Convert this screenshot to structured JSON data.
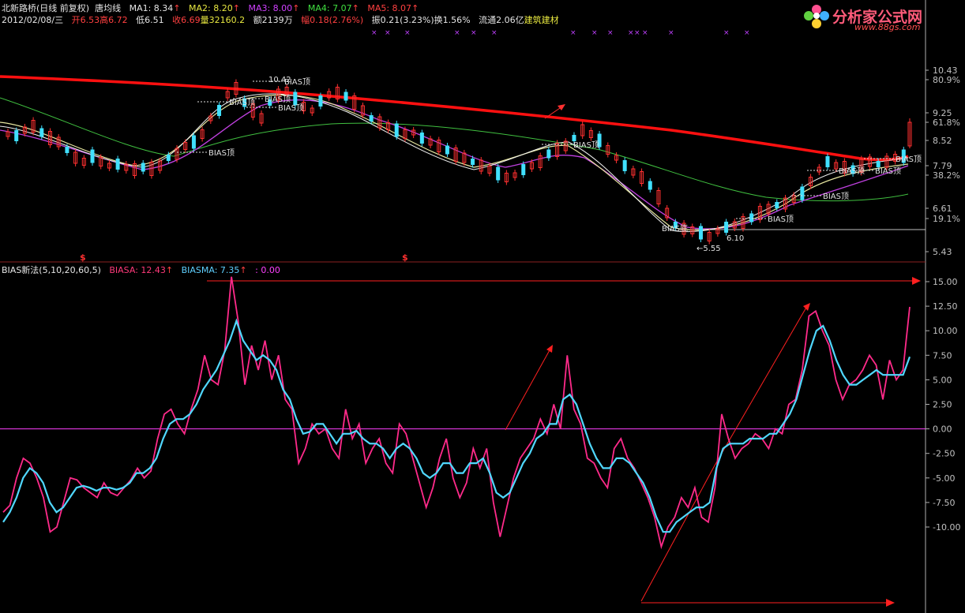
{
  "header": {
    "stock_name": "北新路桥",
    "period": "(日线 前复权)",
    "indicator_name": "唐均线",
    "ma1": "MA1: 8.34",
    "ma2": "MA2: 8.20",
    "ma3": "MA3: 8.00",
    "ma4": "MA4: 7.07",
    "ma5": "MA5: 8.07",
    "date": "2012/02/08/三",
    "open": "开6.53",
    "high": "高6.72",
    "low": "低6.51",
    "close": "收6.69",
    "volume": "量32160.2",
    "amount": "额2139万",
    "change": "幅0.18(2.76%)",
    "amplitude": "振0.21(3.23%)",
    "turnover": "换1.56%",
    "float_cap": "流通2.06亿",
    "sector": "建筑建材",
    "arrow": "↑"
  },
  "logo": {
    "title": "分析家公式网",
    "url": "www.88gs.com"
  },
  "indicator_header": {
    "name": "BIAS新法(5,10,20,60,5)",
    "biasa": "BIASA: 12.43",
    "biasma": "BIASMA: 7.35",
    "extra": ": 0.00"
  },
  "price_axis": {
    "labels": [
      "10.43",
      "80.9%",
      "9.25",
      "61.8%",
      "8.52",
      "7.79",
      "38.2%",
      "6.61",
      "19.1%",
      "5.43"
    ]
  },
  "indicator_axis": {
    "labels": [
      "15.00",
      "12.50",
      "10.00",
      "7.50",
      "5.00",
      "2.50",
      "0.00",
      "-2.50",
      "-5.00",
      "-7.50",
      "-10.00"
    ]
  },
  "annotations": {
    "bias_top": "BIAS顶",
    "bias_bottom": "BIAS底",
    "high_mark": "10.42",
    "low_mark": "5.55",
    "low_mark2": "6.10",
    "signal_mark": "$"
  },
  "colors": {
    "background": "#000000",
    "ma_long": "#ff1010",
    "ma_purple": "#c040e0",
    "ma_green": "#40c040",
    "ma_yellow": "#e8e8a0",
    "ma_white": "#f0f0f0",
    "candle_up": "#ff3030",
    "candle_down": "#40e0ff",
    "biasa_line": "#ff2a8a",
    "biasma_line": "#50d8ff",
    "zero_line": "#ff40ff"
  },
  "chart_data": {
    "type": "line",
    "title": "BIAS新法(5,10,20,60,5)",
    "ylim": [
      -12,
      16
    ],
    "series": [
      {
        "name": "BIASA",
        "values": [
          -8.5,
          -7.8,
          -5,
          -3,
          -3.5,
          -5,
          -7,
          -10.5,
          -10,
          -7.5,
          -5,
          -5.2,
          -6,
          -6.5,
          -7,
          -5.5,
          -6.5,
          -6.8,
          -6,
          -5.2,
          -4,
          -5,
          -4.3,
          -1,
          1.5,
          2,
          0.5,
          -0.5,
          2,
          4,
          7.5,
          5,
          4.5,
          8,
          15.5,
          11,
          4.5,
          8.5,
          6,
          9,
          5,
          7.5,
          3,
          2,
          -3.5,
          -2,
          0.5,
          -0.5,
          0,
          -2,
          -3,
          2,
          -1,
          0.5,
          -3.5,
          -2,
          -1,
          -3.5,
          -4.5,
          0.5,
          -0.5,
          -3,
          -5.5,
          -8,
          -6,
          -3,
          -1,
          -5,
          -7,
          -5.5,
          -2,
          -4,
          -2,
          -7.5,
          -11,
          -8,
          -5,
          -3,
          -2,
          -1,
          1,
          -0.5,
          2.5,
          0,
          7.5,
          2,
          0.5,
          -3,
          -3.5,
          -5,
          -6,
          -2,
          -1,
          -3,
          -4,
          -5.5,
          -7,
          -9,
          -12,
          -10,
          -9,
          -7,
          -8,
          -6,
          -9,
          -9.5,
          -6,
          1.5,
          -1,
          -3,
          -2,
          -1.5,
          -0.5,
          -1,
          -2,
          0,
          -0.5,
          2.5,
          3,
          6,
          11.5,
          12,
          10,
          8.5,
          5,
          3,
          4.5,
          5,
          6,
          7.5,
          6.5,
          3,
          7,
          5,
          6,
          12.43
        ]
      },
      {
        "name": "BIASMA",
        "values": [
          -9.5,
          -8.5,
          -7,
          -5,
          -4,
          -4.5,
          -5.5,
          -7.5,
          -8.5,
          -8,
          -7,
          -6,
          -5.8,
          -6,
          -6.3,
          -6,
          -6,
          -6.2,
          -6,
          -5.5,
          -4.5,
          -4.5,
          -4,
          -3,
          -1,
          0.5,
          1,
          1,
          1.5,
          2.5,
          4,
          5,
          6,
          7.5,
          9,
          11,
          9,
          8,
          7,
          7.5,
          7,
          6,
          4,
          3,
          1,
          -0.5,
          -0.3,
          0.5,
          0.5,
          -0.5,
          -1.5,
          -0.5,
          -0.5,
          -0.2,
          -1,
          -1.5,
          -1.5,
          -2,
          -3,
          -2,
          -1.5,
          -2,
          -3,
          -4.5,
          -5,
          -4.5,
          -3.5,
          -3.5,
          -4.5,
          -4.5,
          -3.5,
          -3.5,
          -3,
          -4.5,
          -6.5,
          -7,
          -6.5,
          -5,
          -3.5,
          -2.5,
          -1,
          -0.5,
          0.5,
          0.5,
          3,
          3.5,
          2.5,
          0.5,
          -1.5,
          -3,
          -4,
          -4,
          -3,
          -3,
          -3.5,
          -4.5,
          -5.5,
          -7,
          -9,
          -10.5,
          -10.5,
          -9.5,
          -9,
          -8.5,
          -8,
          -8,
          -7.5,
          -4,
          -2,
          -1.5,
          -1.5,
          -1.5,
          -1,
          -1,
          -1,
          -0.5,
          -0.5,
          0.5,
          1.5,
          3,
          5.5,
          8,
          10,
          10.5,
          9,
          7,
          5.5,
          4.5,
          4.5,
          5,
          5.5,
          6,
          5.5,
          5.5,
          5.5,
          5.5,
          7.35
        ]
      }
    ]
  }
}
